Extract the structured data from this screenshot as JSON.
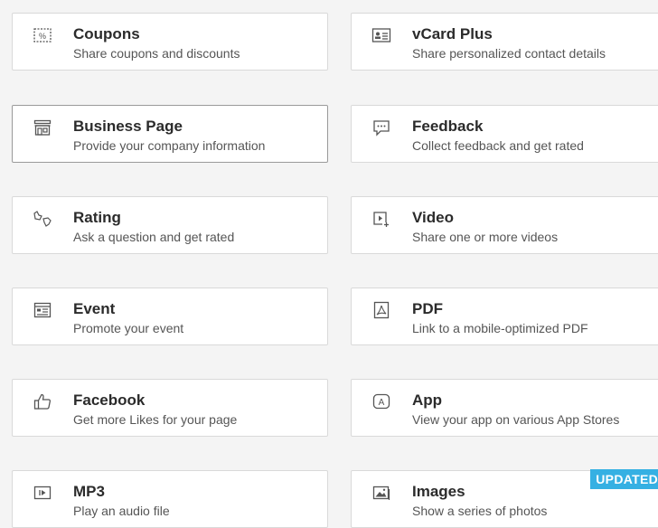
{
  "cards": [
    {
      "title": "Coupons",
      "desc": "Share coupons and discounts",
      "icon": "coupon-icon"
    },
    {
      "title": "vCard Plus",
      "desc": "Share personalized contact details",
      "icon": "vcard-icon"
    },
    {
      "title": "Business Page",
      "desc": "Provide your company information",
      "icon": "store-icon"
    },
    {
      "title": "Feedback",
      "desc": "Collect feedback and get rated",
      "icon": "feedback-icon"
    },
    {
      "title": "Rating",
      "desc": "Ask a question and get rated",
      "icon": "thumbs-icon"
    },
    {
      "title": "Video",
      "desc": "Share one or more videos",
      "icon": "video-icon"
    },
    {
      "title": "Event",
      "desc": "Promote your event",
      "icon": "event-icon"
    },
    {
      "title": "PDF",
      "desc": "Link to a mobile-optimized PDF",
      "icon": "pdf-icon"
    },
    {
      "title": "Facebook",
      "desc": "Get more Likes for your page",
      "icon": "like-icon"
    },
    {
      "title": "App",
      "desc": "View your app on various App Stores",
      "icon": "app-icon"
    },
    {
      "title": "MP3",
      "desc": "Play an audio file",
      "icon": "audio-icon"
    },
    {
      "title": "Images",
      "desc": "Show a series of photos",
      "icon": "images-icon"
    }
  ],
  "images_badge": "UPDATED",
  "colors": {
    "badge": "#35b0e3",
    "icon": "#555555"
  }
}
